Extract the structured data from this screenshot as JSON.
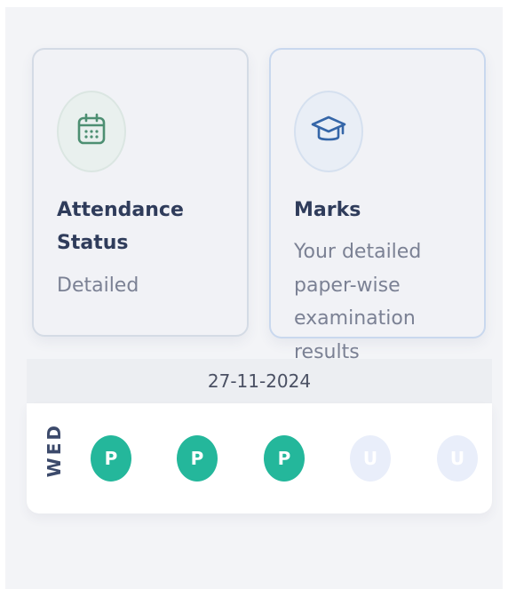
{
  "cards": {
    "attendance": {
      "icon": "calendar-icon",
      "title_line1": "Attendance",
      "title_line2": "Status",
      "subtitle": "Detailed"
    },
    "marks": {
      "icon": "graduation-cap-icon",
      "title": "Marks",
      "subtitle_lines": [
        "Your detailed",
        "paper-wise",
        "examination",
        "results"
      ]
    }
  },
  "attendance_day": {
    "date": "27-11-2024",
    "day": "WED",
    "periods": [
      {
        "status": "P"
      },
      {
        "status": "P"
      },
      {
        "status": "P"
      },
      {
        "status": "U"
      },
      {
        "status": "U"
      }
    ]
  },
  "colors": {
    "present": "#24b79b",
    "unmarked": "#e9eefa",
    "calendar_icon": "#4d8f72",
    "cap_icon": "#3566a8"
  }
}
